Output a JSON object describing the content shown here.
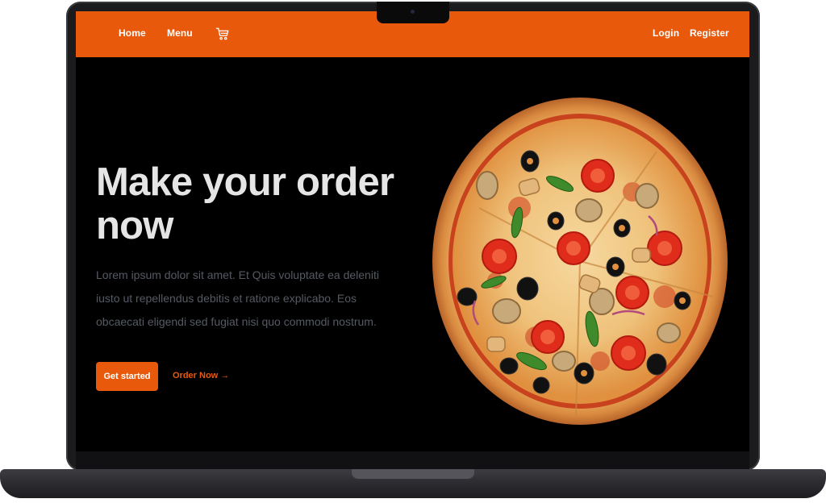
{
  "navbar": {
    "links": [
      "Home",
      "Menu"
    ],
    "cart_icon": "cart-icon",
    "auth": [
      "Login",
      "Register"
    ]
  },
  "hero": {
    "title_line1": "Make your order",
    "title_line2": "now",
    "description": "Lorem ipsum dolor sit amet. Et Quis voluptate ea deleniti iusto ut repellendus debitis et ratione explicabo. Eos obcaecati eligendi sed fugiat nisi quo commodi nostrum.",
    "primary_button": "Get started",
    "secondary_link": "Order Now →"
  },
  "image": {
    "subject": "pizza-image"
  },
  "colors": {
    "accent": "#e8590c",
    "background": "#000000",
    "title": "#e5e5e5",
    "body_text": "#555a63"
  }
}
